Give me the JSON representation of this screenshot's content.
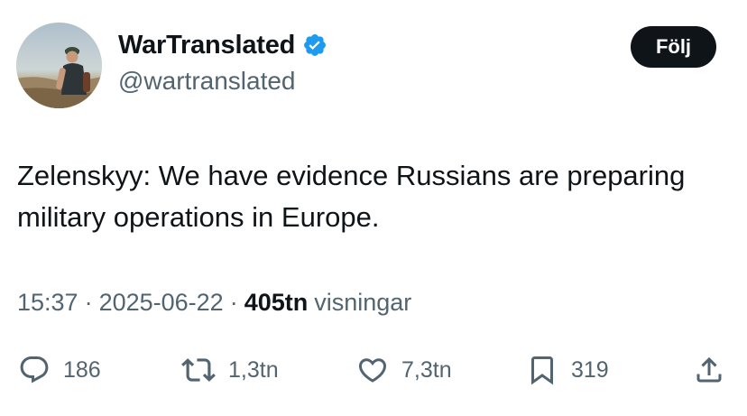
{
  "author": {
    "display_name": "WarTranslated",
    "handle": "@wartranslated",
    "verified": true,
    "avatar": "profile-photo"
  },
  "follow_button": {
    "label": "Följ"
  },
  "tweet": {
    "text": "Zelenskyy: We have evidence Russians are preparing military operations in Europe.",
    "time": "15:37",
    "separator": "·",
    "date": "2025-06-22",
    "views_count": "405tn",
    "views_label": "visningar"
  },
  "actions": {
    "reply": {
      "icon": "reply-icon",
      "count": "186"
    },
    "retweet": {
      "icon": "retweet-icon",
      "count": "1,3tn"
    },
    "like": {
      "icon": "heart-icon",
      "count": "7,3tn"
    },
    "bookmark": {
      "icon": "bookmark-icon",
      "count": "319"
    },
    "share": {
      "icon": "share-icon"
    }
  },
  "colors": {
    "text_primary": "#0f1419",
    "text_secondary": "#536471",
    "verified_blue": "#1d9bf0",
    "follow_bg": "#0f1419"
  }
}
